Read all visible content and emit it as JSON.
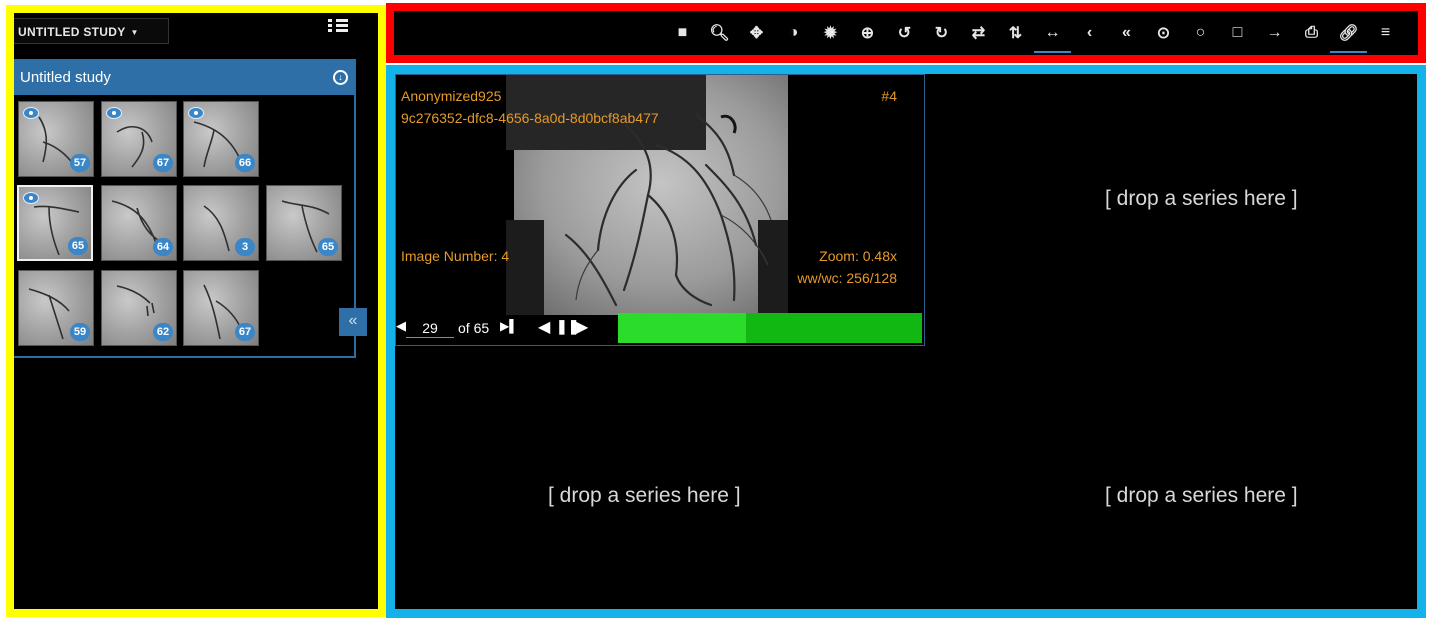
{
  "left_panel": {
    "study_dropdown_label": "UNTITLED STUDY",
    "study_title": "Untitled study",
    "thumbnails": [
      {
        "count": "57",
        "viewed": true,
        "selected": false
      },
      {
        "count": "67",
        "viewed": true,
        "selected": false
      },
      {
        "count": "66",
        "viewed": true,
        "selected": false
      },
      {
        "count": "65",
        "viewed": true,
        "selected": true
      },
      {
        "count": "64",
        "viewed": false,
        "selected": false
      },
      {
        "count": "3",
        "viewed": false,
        "selected": false
      },
      {
        "count": "65",
        "viewed": false,
        "selected": false
      },
      {
        "count": "59",
        "viewed": false,
        "selected": false
      },
      {
        "count": "62",
        "viewed": false,
        "selected": false
      },
      {
        "count": "67",
        "viewed": false,
        "selected": false
      }
    ],
    "collapse_glyph": "«"
  },
  "toolbar": {
    "tools": [
      {
        "name": "stop-icon",
        "glyph": "■",
        "active": false
      },
      {
        "name": "search-icon",
        "glyph": "🔍︎",
        "active": false
      },
      {
        "name": "move-icon",
        "glyph": "✥",
        "active": false
      },
      {
        "name": "contrast-icon",
        "glyph": "◑",
        "active": false
      },
      {
        "name": "brightness-icon",
        "glyph": "✹",
        "active": false
      },
      {
        "name": "zoom-in-icon",
        "glyph": "⊕",
        "active": false
      },
      {
        "name": "rotate-left-icon",
        "glyph": "↺",
        "active": false
      },
      {
        "name": "rotate-right-icon",
        "glyph": "↻",
        "active": false
      },
      {
        "name": "flip-horizontal-icon",
        "glyph": "⇄",
        "active": false
      },
      {
        "name": "flip-vertical-icon",
        "glyph": "⇅",
        "active": false
      },
      {
        "name": "measure-length-icon",
        "glyph": "↔",
        "active": true
      },
      {
        "name": "angle-icon",
        "glyph": "‹",
        "active": false
      },
      {
        "name": "cobb-angle-icon",
        "glyph": "«",
        "active": false
      },
      {
        "name": "probe-icon",
        "glyph": "⊙",
        "active": false
      },
      {
        "name": "ellipse-roi-icon",
        "glyph": "○",
        "active": false
      },
      {
        "name": "rectangle-roi-icon",
        "glyph": "□",
        "active": false
      },
      {
        "name": "arrow-annotate-icon",
        "glyph": "→",
        "active": false
      },
      {
        "name": "print-icon",
        "glyph": "⎙",
        "active": false
      },
      {
        "name": "link-icon",
        "glyph": "🔗︎",
        "active": true
      },
      {
        "name": "menu-icon",
        "glyph": "≡",
        "active": false
      }
    ]
  },
  "viewer": {
    "patient_name": "Anonymized925",
    "series_uid": "9c276352-dfc8-4656-8a0d-8d0bcf8ab477",
    "image_tag": "#4",
    "image_number": "Image Number: 4",
    "zoom": "Zoom: 0.48x",
    "window": "ww/wc: 256/128",
    "frame_value": "29",
    "frame_total": "of 65",
    "load_fraction": 0.42,
    "drop_text": "[ drop a series here ]"
  },
  "colors": {
    "left_frame": "#ffff00",
    "toolbar_frame": "#ff0000",
    "viewer_frame": "#13b2ea",
    "accent": "#2d6fa6",
    "overlay_text": "#e59a2a",
    "cine_bar": "#12b812"
  }
}
